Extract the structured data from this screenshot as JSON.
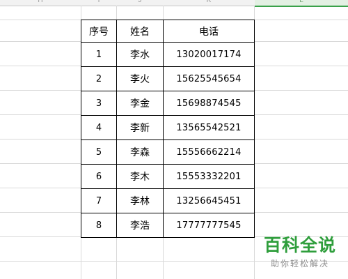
{
  "column_headers": [
    {
      "id": "H",
      "label": "H"
    },
    {
      "id": "I",
      "label": "I"
    },
    {
      "id": "J",
      "label": "J"
    },
    {
      "id": "K",
      "label": "K"
    },
    {
      "id": "L",
      "label": "L"
    }
  ],
  "table": {
    "headers": [
      "序号",
      "姓名",
      "电话"
    ],
    "rows": [
      {
        "index": "1",
        "name": "李水",
        "phone": "13020017174"
      },
      {
        "index": "2",
        "name": "李火",
        "phone": "15625545654"
      },
      {
        "index": "3",
        "name": "李金",
        "phone": "15698874545"
      },
      {
        "index": "4",
        "name": "李新",
        "phone": "13565542521"
      },
      {
        "index": "5",
        "name": "李森",
        "phone": "15556662214"
      },
      {
        "index": "6",
        "name": "李木",
        "phone": "15553332201"
      },
      {
        "index": "7",
        "name": "李林",
        "phone": "13256645451"
      },
      {
        "index": "8",
        "name": "李浩",
        "phone": "17777777545"
      }
    ]
  },
  "watermark": {
    "title": "百科全说",
    "subtitle": "助你轻松解决",
    "color": "#2f9e3c"
  }
}
